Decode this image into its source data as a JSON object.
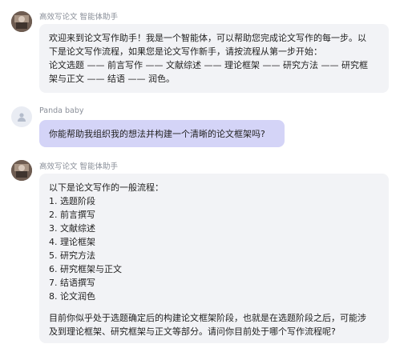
{
  "messages": [
    {
      "role": "assistant",
      "sender": "高效写论文 智能体助手",
      "lines": [
        "欢迎来到论文写作助手！我是一个智能体，可以帮助您完成论文写作的每一步。以",
        "下是论文写作流程，如果您是论文写作新手，请按流程从第一步开始：",
        "论文选题 —— 前言写作 —— 文献综述 —— 理论框架 —— 研究方法 —— 研究框",
        "架与正文 —— 结语 —— 润色。"
      ]
    },
    {
      "role": "user",
      "sender": "Panda baby",
      "lines": [
        "你能帮助我组织我的想法并构建一个清晰的论文框架吗?"
      ]
    },
    {
      "role": "assistant",
      "sender": "高效写论文 智能体助手",
      "intro": "以下是论文写作的一般流程：",
      "steps": [
        "1. 选题阶段",
        "2. 前言撰写",
        "3. 文献综述",
        "4. 理论框架",
        "5. 研究方法",
        "6. 研究框架与正文",
        "7. 结语撰写",
        "8. 论文润色"
      ],
      "outro_lines": [
        "目前你似乎处于选题确定后的构建论文框架阶段，也就是在选题阶段之后，可能涉",
        "及到理论框架、研究框架与正文等部分。请问你目前处于哪个写作流程呢?"
      ]
    }
  ]
}
